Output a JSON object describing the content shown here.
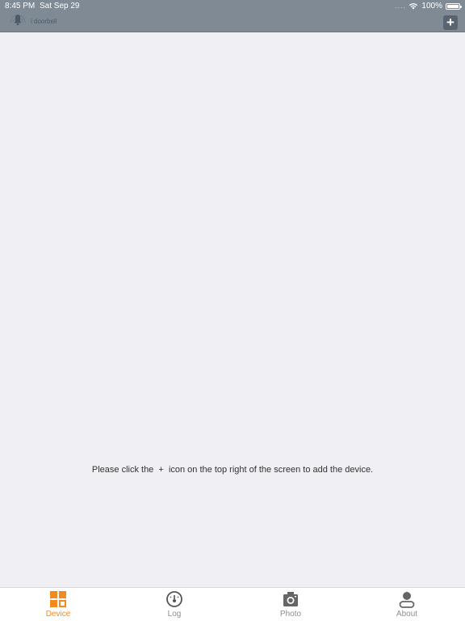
{
  "status_bar": {
    "time": "8:45 PM",
    "date": "Sat Sep 29",
    "battery": "100%",
    "battery_level": 1.0
  },
  "header": {
    "brand_text": "i doorbell",
    "add_icon": "plus-icon",
    "add_label": "+"
  },
  "main": {
    "empty_message": "Please click the  +  icon on the top right of the screen to add the device."
  },
  "tabs": [
    {
      "label": "Device",
      "icon": "grid-icon",
      "active": true
    },
    {
      "label": "Log",
      "icon": "gauge-icon",
      "active": false
    },
    {
      "label": "Photo",
      "icon": "camera-icon",
      "active": false
    },
    {
      "label": "About",
      "icon": "person-icon",
      "active": false
    }
  ],
  "colors": {
    "header": "#7f8a95",
    "accent": "#f28a1e",
    "tab_inactive": "#8e8e93",
    "background": "#efeff4"
  }
}
